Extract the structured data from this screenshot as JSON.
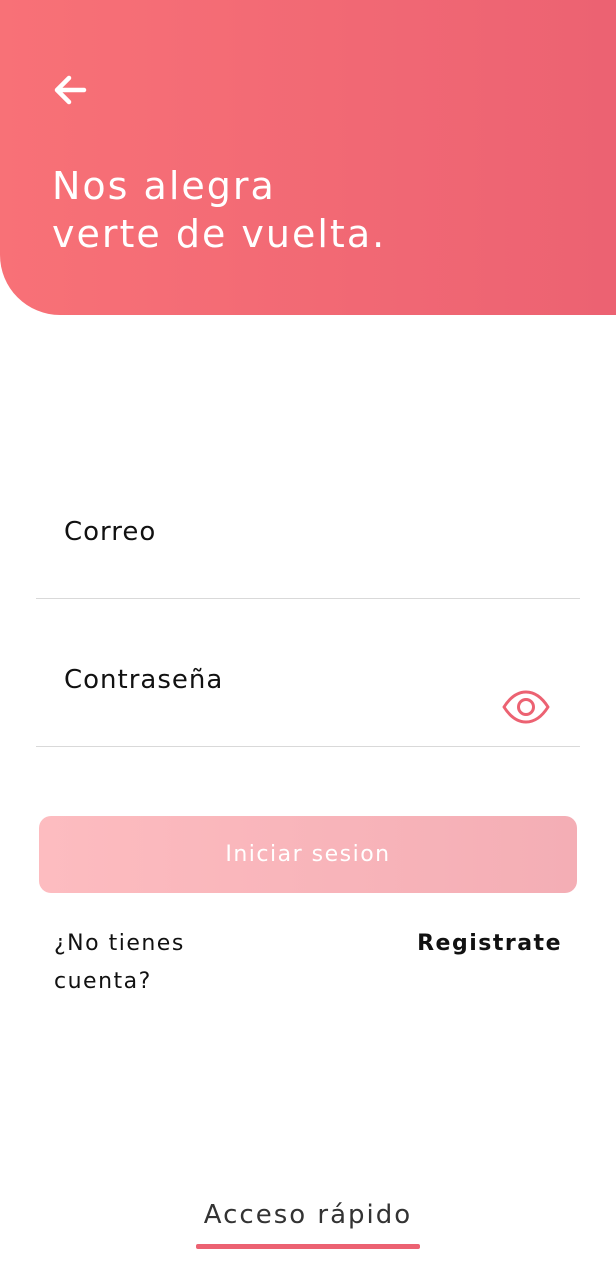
{
  "header": {
    "back_icon": "arrow-left-icon",
    "title": "Nos alegra\nverte de vuelta."
  },
  "form": {
    "email_label": "Correo",
    "email_value": "",
    "password_label": "Contraseña",
    "password_value": "",
    "visibility_icon": "eye-icon",
    "login_label": "Iniciar sesion",
    "login_enabled": false
  },
  "register": {
    "prompt": "¿No tienes cuenta?",
    "link_label": "Registrate"
  },
  "footer": {
    "quick_access_label": "Acceso rápido"
  },
  "colors": {
    "header_gradient_start": "#f87177",
    "header_gradient_end": "#ec6272",
    "button_disabled": "#fdbcc0",
    "accent": "#ec6272"
  }
}
